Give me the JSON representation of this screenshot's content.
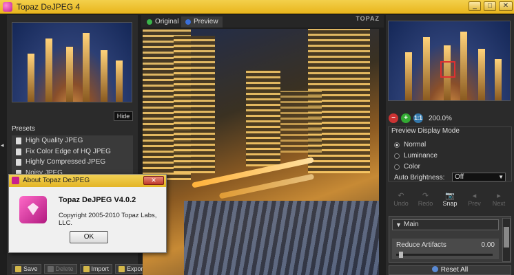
{
  "window": {
    "title": "Topaz DeJPEG 4",
    "controls": [
      "_",
      "□",
      "✕"
    ]
  },
  "left_panel": {
    "hide_label": "Hide",
    "presets_label": "Presets",
    "presets": [
      "High Quality JPEG",
      "Fix Color Edge of HQ JPEG",
      "Highly Compressed JPEG",
      "Noisy JPEG"
    ],
    "toolbar": [
      {
        "label": "Save",
        "enabled": true
      },
      {
        "label": "Delete",
        "enabled": false
      },
      {
        "label": "Import",
        "enabled": true
      },
      {
        "label": "Export",
        "enabled": true
      }
    ]
  },
  "center": {
    "tabs": [
      {
        "label": "Original",
        "color": "#3ab54a"
      },
      {
        "label": "Preview",
        "color": "#3a6fd8"
      }
    ],
    "active_tab": "Preview",
    "brand_mark": "TOPAZ"
  },
  "right_panel": {
    "zoom": {
      "level": "200.0%",
      "out_symbol": "−",
      "in_symbol": "+",
      "fit_symbol": "1:1"
    },
    "preview_display_mode": {
      "title": "Preview Display Mode",
      "options": [
        "Normal",
        "Luminance",
        "Color"
      ],
      "selected": "Normal",
      "auto_brightness_label": "Auto Brightness:",
      "auto_brightness_value": "Off"
    },
    "history_buttons": [
      {
        "label": "Undo",
        "enabled": false,
        "icon": "↶"
      },
      {
        "label": "Redo",
        "enabled": false,
        "icon": "↷"
      },
      {
        "label": "Snap",
        "enabled": true,
        "icon": "📷"
      },
      {
        "label": "Prev",
        "enabled": false,
        "icon": "◂"
      },
      {
        "label": "Next",
        "enabled": false,
        "icon": "▸"
      }
    ],
    "main_section": {
      "title": "Main",
      "param_label": "Reduce Artifacts",
      "param_value": "0.00"
    },
    "reset_label": "Reset All"
  },
  "about_dialog": {
    "title": "About Topaz DeJPEG",
    "close_symbol": "✕",
    "product_name": "Topaz DeJPEG V4.0.2",
    "copyright": "Copyright 2005-2010 Topaz Labs, LLC.",
    "ok_label": "OK"
  }
}
